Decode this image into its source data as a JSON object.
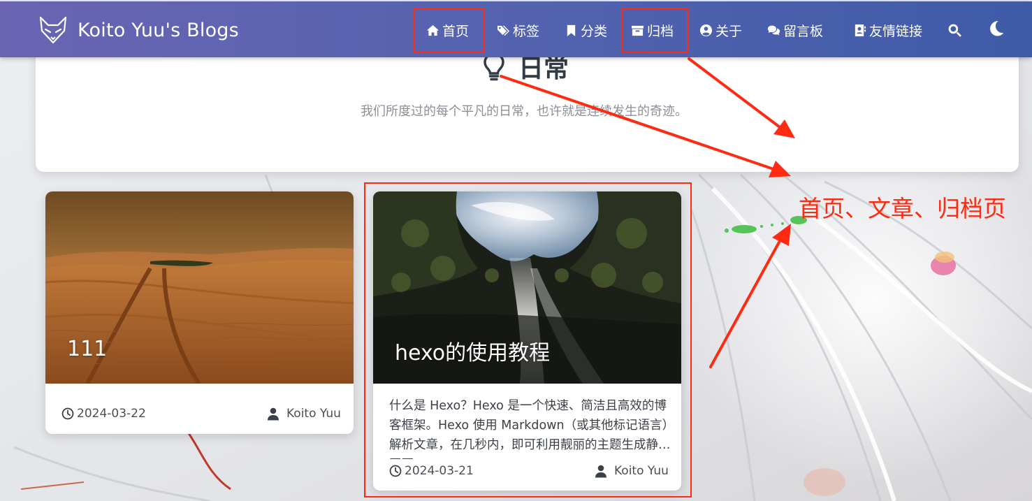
{
  "site": {
    "title": "Koito Yuu's Blogs"
  },
  "nav": {
    "items": [
      {
        "label": "首页",
        "icon": "home-icon"
      },
      {
        "label": "标签",
        "icon": "tags-icon"
      },
      {
        "label": "分类",
        "icon": "bookmark-icon"
      },
      {
        "label": "归档",
        "icon": "archive-icon"
      },
      {
        "label": "关于",
        "icon": "user-circle-icon"
      },
      {
        "label": "留言板",
        "icon": "comments-icon"
      },
      {
        "label": "友情链接",
        "icon": "address-book-icon"
      }
    ],
    "search_icon": "search-icon",
    "theme_icon": "moon-icon"
  },
  "header": {
    "title": "日常",
    "subtitle": "我们所度过的每个平凡的日常，也许就是连续发生的奇迹。",
    "icon": "lightbulb-icon"
  },
  "posts": [
    {
      "title": "111",
      "date": "2024-03-22",
      "author": "Koito Yuu",
      "cover": "desert-dunes"
    },
    {
      "title": "hexo的使用教程",
      "excerpt": "什么是 Hexo？Hexo 是一个快速、简洁且高效的博客框架。Hexo 使用 Markdown（或其他标记语言）解析文章，在几秒内，即可利用靓丽的主题生成静态网页。",
      "date": "2024-03-21",
      "author": "Koito Yuu",
      "cover": "cave-waterfall"
    }
  ],
  "annotation": {
    "text": "首页、文章、归档页",
    "color": "#ff2a12"
  },
  "colors": {
    "navbar_start": "#6a64b3",
    "navbar_end": "#3f5ba8",
    "annotation": "#ff2a12"
  }
}
